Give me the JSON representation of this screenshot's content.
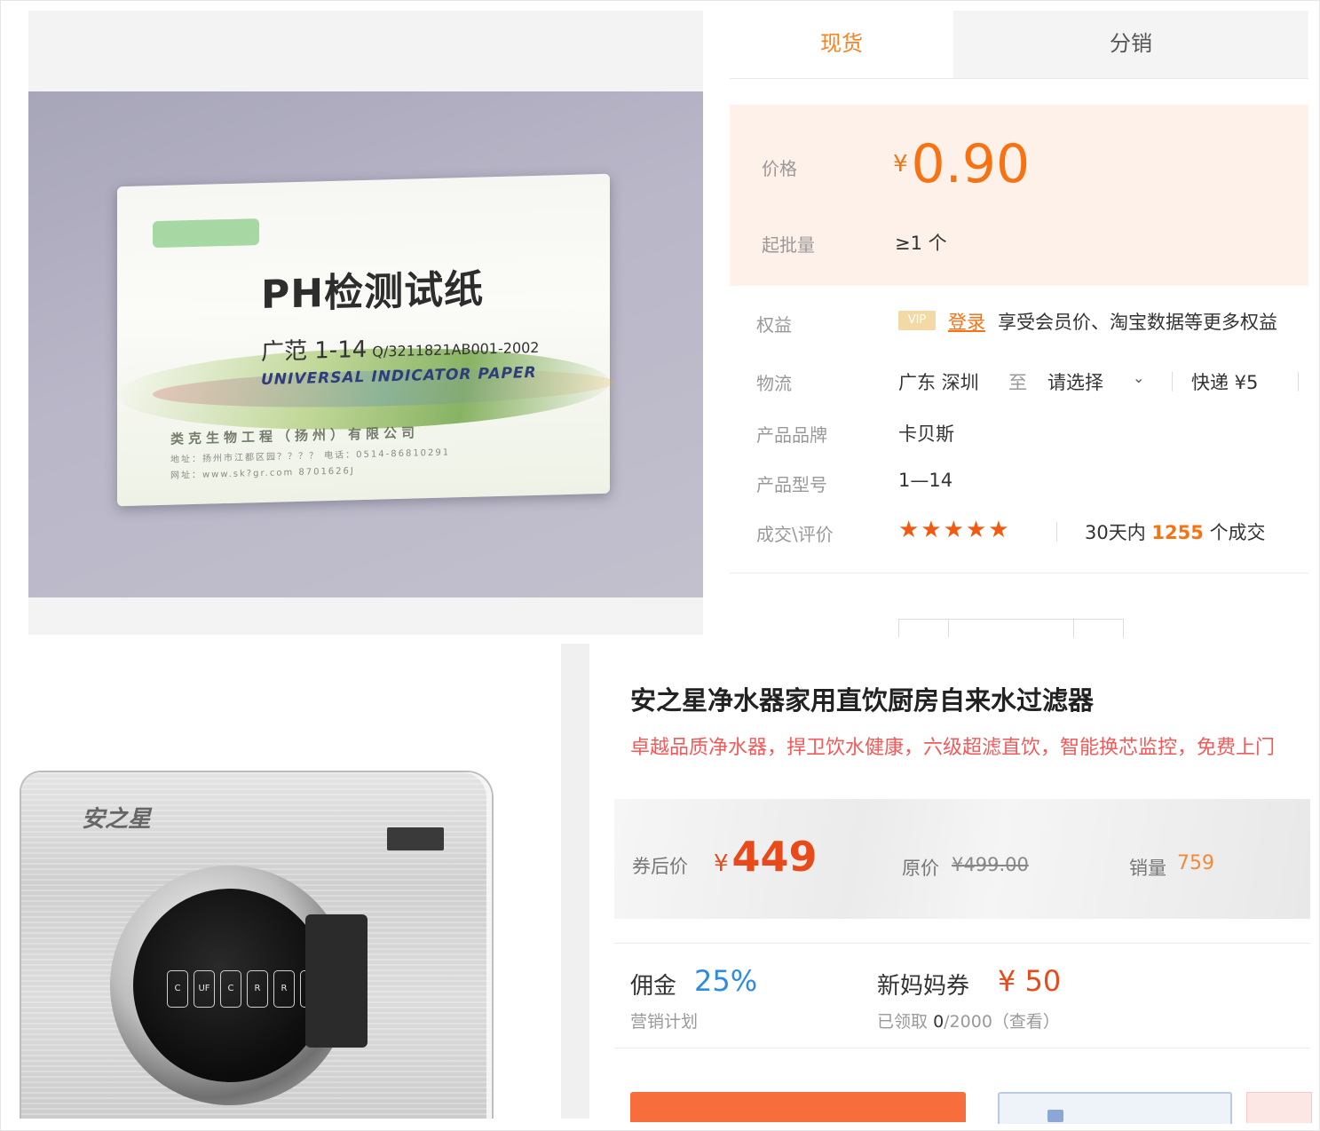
{
  "top_product": {
    "image": {
      "title": "PH检测试纸",
      "range": "广范 1-14",
      "standard": "Q/3211821AB001-2002",
      "english": "UNIVERSAL INDICATOR PAPER",
      "company": "类克生物工程（扬州）有限公司",
      "address": "地址：扬州市江都区园？？？？ 电话：0514-86810291",
      "website": "网址：www.sk?gr.com 8701626J"
    },
    "tabs": [
      "现货",
      "分销"
    ],
    "active_tab": "现货",
    "price_label": "价格",
    "currency": "¥",
    "price": "0.90",
    "moq_label": "起批量",
    "moq_value": "≥1 个",
    "benefit_label": "权益",
    "vip_badge": "VIP",
    "login_link": "登录",
    "benefit_text": "享受会员价、淘宝数据等更多权益",
    "logistics_label": "物流",
    "origin": "广东 深圳",
    "to": "至",
    "destination": "请选择",
    "shipping": "快递 ¥5",
    "brand_label": "产品品牌",
    "brand_value": "卡贝斯",
    "model_label": "产品型号",
    "model_value": "1—14",
    "deals_label": "成交\\评价",
    "rating_stars": 5,
    "stars_text": "★★★★★",
    "deals_prefix": "30天内",
    "deals_count": "1255",
    "deals_suffix": "个成交"
  },
  "bottom_product": {
    "image": {
      "brand": "安之星",
      "filters": [
        "C",
        "UF",
        "C",
        "R",
        "R",
        "PP"
      ]
    },
    "title": "安之星净水器家用直饮厨房自来水过滤器",
    "subtitle": "卓越品质净水器，捍卫饮水健康，六级超滤直饮，智能换芯监控，免费上门",
    "after_coupon_label": "券后价",
    "currency": "¥",
    "after_coupon_price": "449",
    "original_label": "原价",
    "original_price": "¥499.00",
    "sales_label": "销量",
    "sales_value": "759",
    "commission_label": "佣金",
    "commission_value": "25%",
    "commission_sub": "营销计划",
    "coupon_label": "新妈妈券",
    "coupon_value": "¥ 50",
    "coupon_claimed_prefix": "已领取",
    "coupon_claimed": "0",
    "coupon_total": "/2000（查看）"
  },
  "colors": {
    "accent_orange": "#f77212",
    "price_box_bg": "#fdf1e9",
    "commission_blue": "#2d8be0",
    "subtitle_red": "#f25a5a",
    "star": "#f25a12"
  }
}
